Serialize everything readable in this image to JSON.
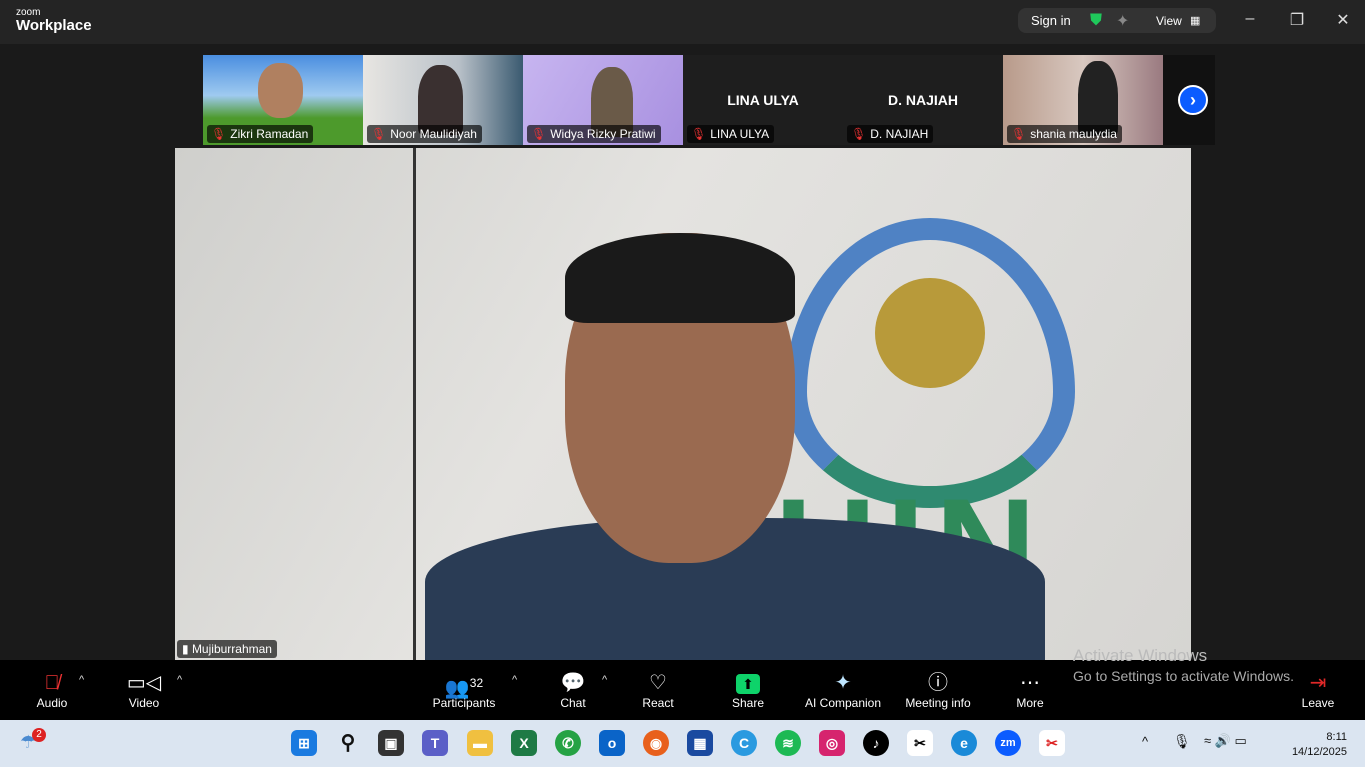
{
  "app": {
    "logo_small": "zoom",
    "logo_big": "Workplace",
    "sign_in": "Sign in",
    "view": "View"
  },
  "participants_strip": [
    {
      "name": "Zikri Ramadan",
      "muted": true
    },
    {
      "name": "Noor Maulidiyah",
      "muted": true
    },
    {
      "name": "Widya Rizky Pratiwi",
      "muted": true
    },
    {
      "name": "LINA ULYA",
      "muted": true,
      "display": "LINA ULYA"
    },
    {
      "name": "D. NAJIAH",
      "muted": true,
      "display": "D. NAJIAH"
    },
    {
      "name": "shania maulydia",
      "muted": true
    }
  ],
  "main_speaker": {
    "name": "Mujiburrahman",
    "backdrop_text": "UIN"
  },
  "toolbar": {
    "audio": "Audio",
    "video": "Video",
    "participants": "Participants",
    "participants_count": "32",
    "chat": "Chat",
    "react": "React",
    "share": "Share",
    "ai": "AI Companion",
    "info": "Meeting info",
    "more": "More",
    "leave": "Leave"
  },
  "watermark": {
    "line1": "Activate Windows",
    "line2": "Go to Settings to activate Windows."
  },
  "taskbar": {
    "weather_badge": "2",
    "time": "8:11",
    "date": "14/12/2025"
  },
  "colors": {
    "accent": "#0b5cff",
    "share": "#0ed36a",
    "leave": "#e02828"
  }
}
